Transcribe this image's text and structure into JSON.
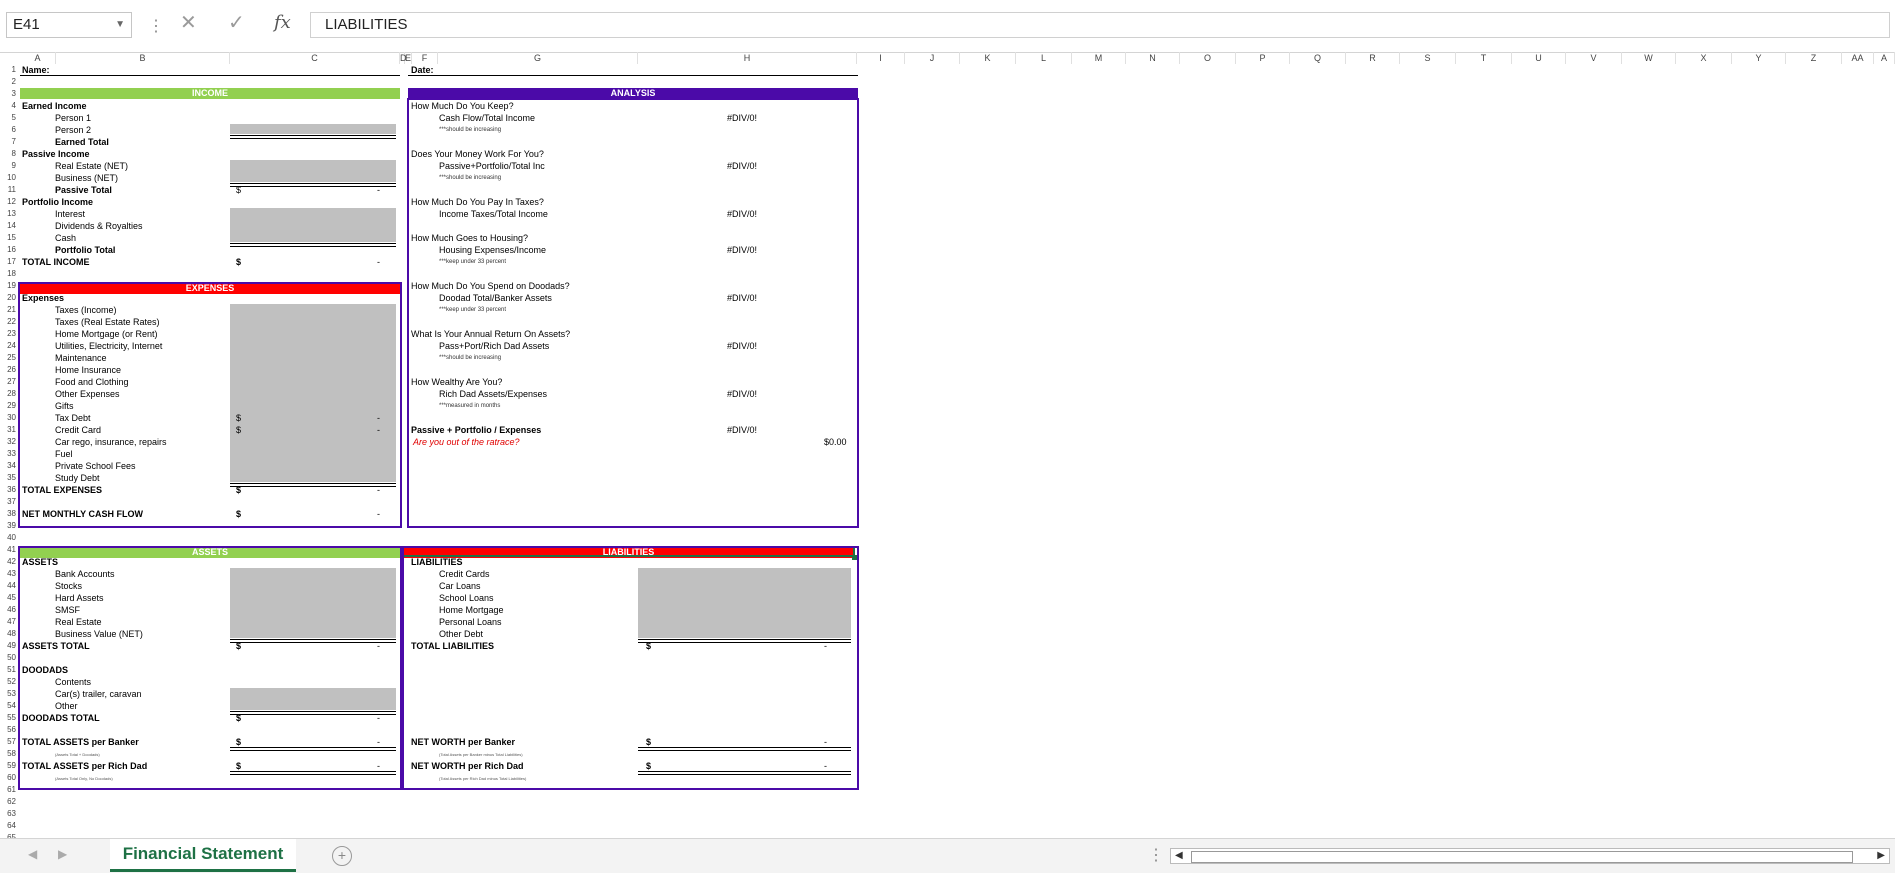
{
  "formula_bar": {
    "name_box": "E41",
    "formula": "LIABILITIES"
  },
  "column_headers": [
    "A",
    "B",
    "C",
    "D",
    "E",
    "F",
    "G",
    "H",
    "I",
    "J",
    "K",
    "L",
    "M",
    "N",
    "O",
    "P",
    "Q",
    "R",
    "S",
    "T",
    "U",
    "V",
    "W",
    "X",
    "Y",
    "Z",
    "AA",
    "A"
  ],
  "top": {
    "name_label": "Name:",
    "date_label": "Date:"
  },
  "income": {
    "header": "INCOME",
    "earned_income": "Earned Income",
    "person1": "Person 1",
    "person2": "Person 2",
    "earned_total": "Earned Total",
    "passive_income": "Passive Income",
    "real_estate": "Real Estate (NET)",
    "business": "Business (NET)",
    "passive_total": "Passive Total",
    "portfolio_income": "Portfolio Income",
    "interest": "Interest",
    "dividends": "Dividends & Royalties",
    "cash": "Cash",
    "portfolio_total": "Portfolio Total",
    "total_income": "TOTAL INCOME"
  },
  "expenses": {
    "header": "EXPENSES",
    "label": "Expenses",
    "items": [
      "Taxes (Income)",
      "Taxes (Real Estate Rates)",
      "Home Mortgage (or Rent)",
      "Utilities, Electricity, Internet",
      "Maintenance",
      "Home Insurance",
      "Food and Clothing",
      "Other Expenses",
      "Gifts",
      "Tax Debt",
      "Credit Card",
      "Car rego, insurance, repairs",
      "Fuel",
      "Private School Fees",
      "Study Debt"
    ],
    "total": "TOTAL EXPENSES",
    "net_cash_flow": "NET MONTHLY CASH FLOW"
  },
  "analysis": {
    "header": "ANALYSIS",
    "q1": "How Much Do You Keep?",
    "q1_metric": "Cash Flow/Total Income",
    "q1_note": "***should be increasing",
    "q2": "Does Your Money Work For You?",
    "q2_metric": "Passive+Portfolio/Total Inc",
    "q2_note": "***should be increasing",
    "q3": "How Much Do You Pay In Taxes?",
    "q3_metric": "Income Taxes/Total Income",
    "q4": "How Much Goes to Housing?",
    "q4_metric": "Housing Expenses/Income",
    "q4_note": "***keep under 33 percent",
    "q5": "How Much Do You Spend on Doodads?",
    "q5_metric": "Doodad Total/Banker Assets",
    "q5_note": "***keep under 33 percent",
    "q6": "What Is Your Annual Return On Assets?",
    "q6_metric": "Pass+Port/Rich Dad Assets",
    "q6_note": "***should be increasing",
    "q7": "How Wealthy Are You?",
    "q7_metric": "Rich Dad Assets/Expenses",
    "q7_note": "***measured in months",
    "q8": "Passive + Portfolio / Expenses",
    "q8_question": "Are you out of the ratrace?",
    "div0": "#DIV/0!",
    "zero": "$0.00"
  },
  "assets": {
    "header": "ASSETS",
    "label": "ASSETS",
    "items": [
      "Bank Accounts",
      "Stocks",
      "Hard Assets",
      "SMSF",
      "Real Estate"
    ],
    "business_value": "Business Value (NET)",
    "assets_total": "ASSETS TOTAL",
    "doodads": "DOODADS",
    "doodad_items": [
      "Contents",
      "Car(s) trailer, caravan",
      "Other"
    ],
    "doodads_total": "DOODADS TOTAL",
    "total_banker": "TOTAL ASSETS per Banker",
    "banker_note": "(Assets Total + Doodads)",
    "total_richdad": "TOTAL ASSETS per Rich Dad",
    "richdad_note": "(Assets Total Only, No Doodads)"
  },
  "liabilities": {
    "header": "LIABILITIES",
    "label": "LIABILITIES",
    "items": [
      "Credit Cards",
      "Car Loans",
      "School Loans",
      "Home Mortgage",
      "Personal Loans",
      "Other Debt"
    ],
    "total": "TOTAL LIABILITIES",
    "nw_banker": "NET WORTH per Banker",
    "nw_banker_note": "(Total Assets per Banker minus Total Liabilities)",
    "nw_richdad": "NET WORTH per Rich Dad",
    "nw_richdad_note": "(Total Assets per Rich Dad minus Total Liabilities)"
  },
  "currency": "$",
  "dash": "-",
  "sheet_tab": "Financial Statement",
  "colors": {
    "green": "#92d050",
    "red": "#ff0000",
    "purple": "#4b0aa8",
    "gray": "#c0c0c0",
    "tab_green": "#1e7145"
  }
}
